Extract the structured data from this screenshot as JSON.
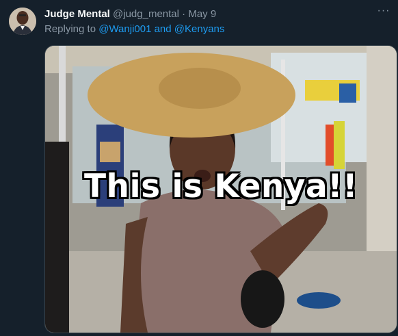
{
  "tweet": {
    "author_name": "Judge Mental",
    "author_handle": "@judg_mental",
    "separator": "·",
    "date": "May 9",
    "more_glyph": "···",
    "reply_prefix": "Replying to ",
    "reply_mentions": "@Wanji001 and @Kenyans",
    "media": {
      "caption": "This is Kenya!!"
    }
  },
  "colors": {
    "background": "#15202b",
    "text_primary": "#f7f9f9",
    "text_secondary": "#8b98a5",
    "link": "#1d9bf0",
    "border": "#38444d"
  },
  "icons": {
    "more": "more-horizontal-icon"
  }
}
